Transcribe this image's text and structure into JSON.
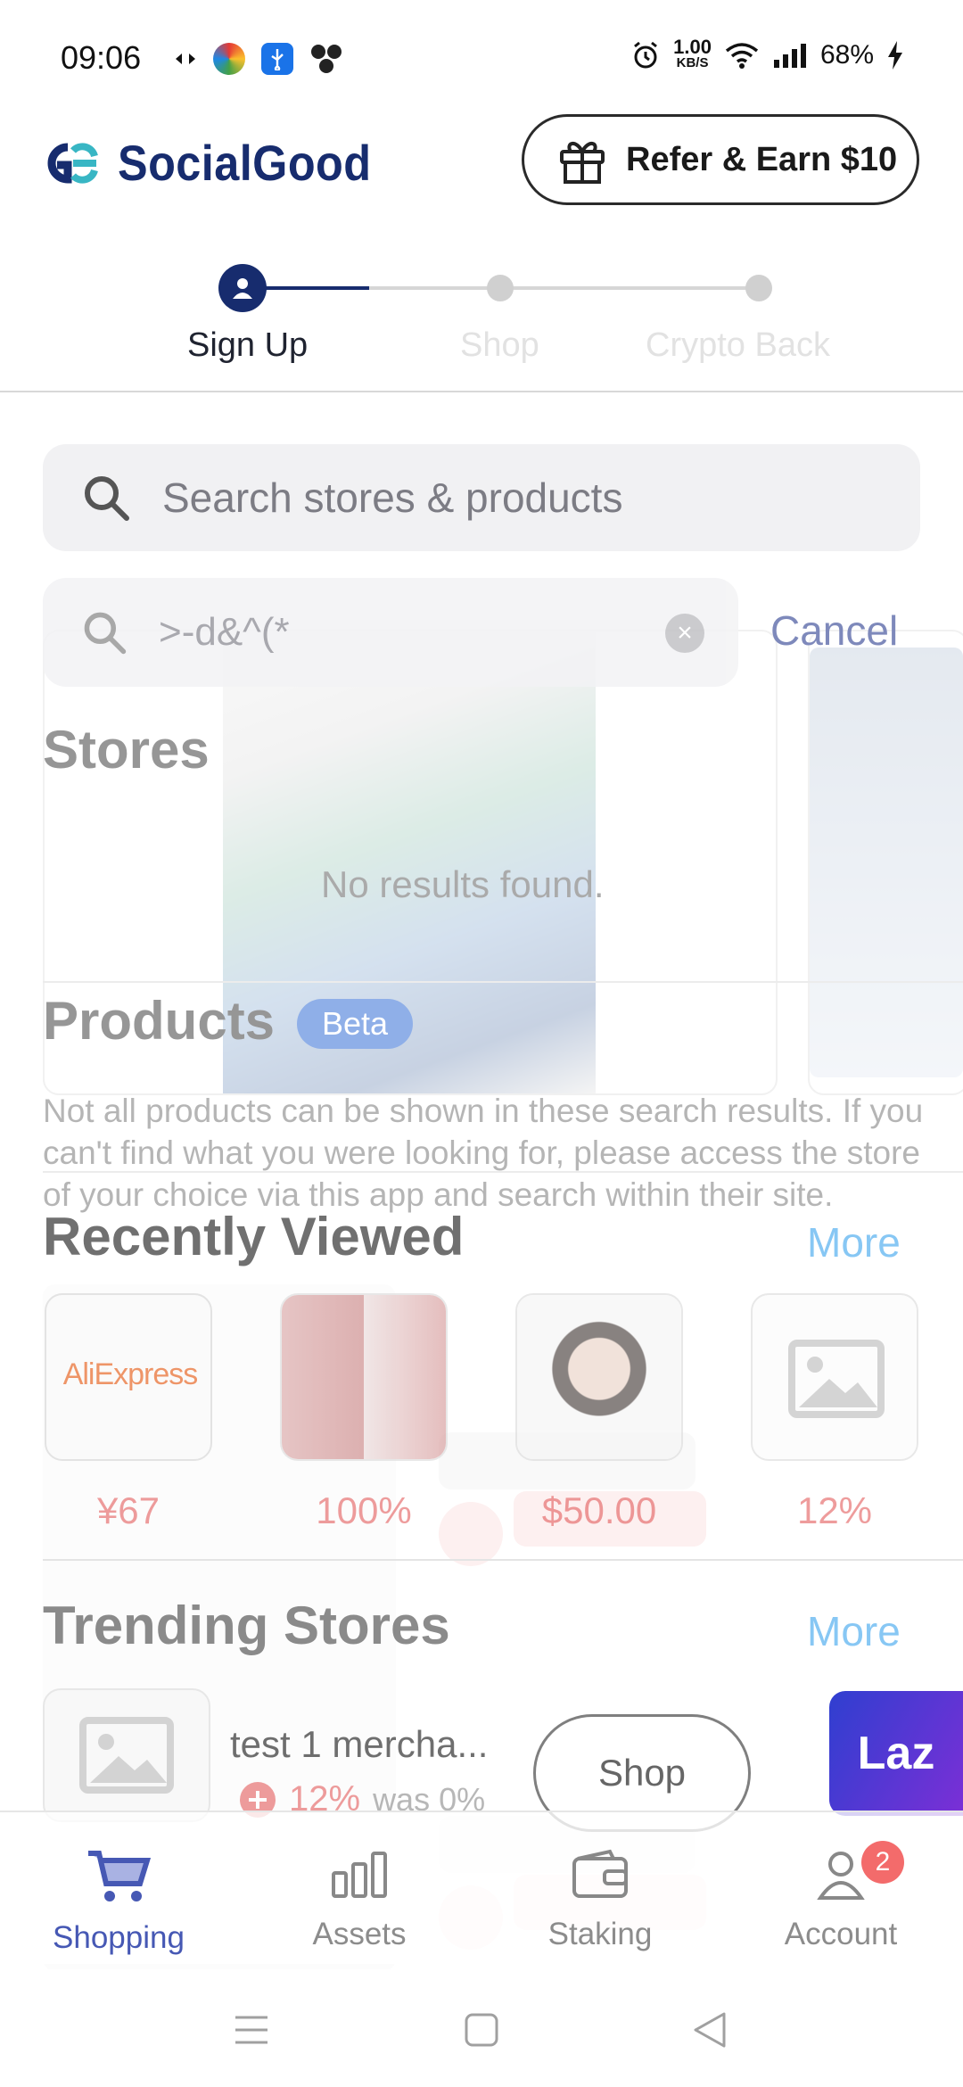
{
  "status_bar": {
    "time": "09:06",
    "net_speed_value": "1.00",
    "net_speed_unit": "KB/S",
    "battery": "68%"
  },
  "header": {
    "brand": "SocialGood",
    "refer_label": "Refer & Earn $10"
  },
  "stepper": {
    "steps": [
      "Sign Up",
      "Shop",
      "Crypto Back"
    ],
    "active_index": 0
  },
  "search": {
    "placeholder": "Search stores & products",
    "query": ">-d&^(*",
    "cancel_label": "Cancel"
  },
  "results": {
    "stores_title": "Stores",
    "no_results": "No results found.",
    "products_title": "Products",
    "beta_label": "Beta",
    "note": "Not all products can be shown in these search results. If you can't find what you were looking for, please access the store of your choice via this app and search within their site."
  },
  "recently_viewed": {
    "title": "Recently Viewed",
    "more_label": "More",
    "items": [
      {
        "name": "AliExpress",
        "value": "¥67"
      },
      {
        "name": "lip-product",
        "value": "100%"
      },
      {
        "name": "portrait",
        "value": "$50.00"
      },
      {
        "name": "placeholder",
        "value": "12%"
      }
    ]
  },
  "trending_stores": {
    "title": "Trending Stores",
    "more_label": "More",
    "items": [
      {
        "name": "test 1 mercha...",
        "cashback": "12%",
        "was": "was 0%",
        "shop_label": "Shop"
      },
      {
        "name": "Laz"
      }
    ]
  },
  "bottom_nav": {
    "items": [
      "Shopping",
      "Assets",
      "Staking",
      "Account"
    ],
    "active_index": 0,
    "account_badge": "2"
  },
  "colors": {
    "brand": "#172c6e",
    "accent": "#4658b4",
    "more": "#5fb4f0",
    "cashback": "#e35a5a"
  }
}
